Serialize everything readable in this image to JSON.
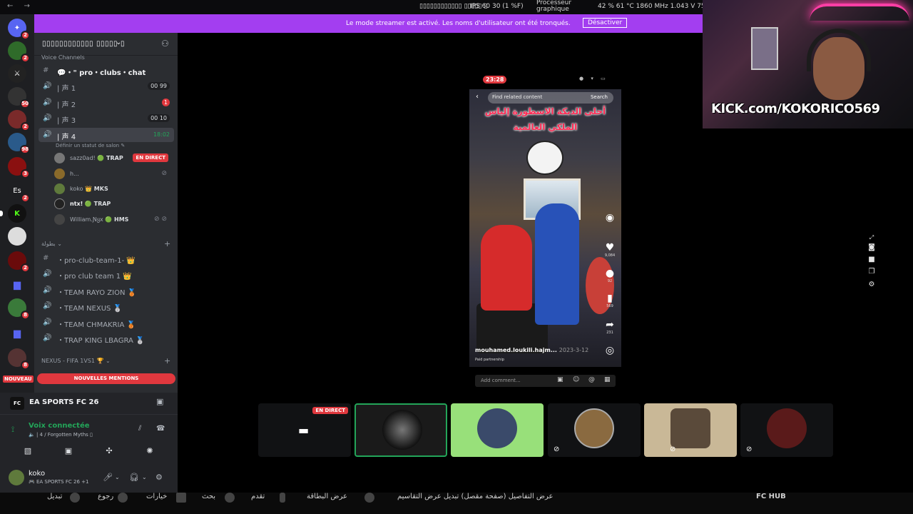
{
  "window": {
    "title": "▯▯▯▯▯▯▯▯▯▯▯▯ ▯▯▯▯▯ ▯",
    "nav_label": "← →",
    "ips": "IPS   60   30 (1 %F)",
    "processor_label": "Processeur graphique",
    "stats": "42 % 61 °C 1860 MHz 1.043 V 75 V"
  },
  "banner": {
    "message": "Le mode streamer est activé. Les noms d'utilisateur ont été tronqués.",
    "button": "Désactiver"
  },
  "server": {
    "name": "▯▯▯▯▯▯▯▯▯▯▯▯ ▯▯▯▯▯ ▯",
    "chevron": "⌄"
  },
  "server_rail": [
    {
      "icon": "discord-icon",
      "badge": "2"
    },
    {
      "icon": "server-icon",
      "badge": "2"
    },
    {
      "icon": "server-icon",
      "badge": ""
    },
    {
      "icon": "server-icon",
      "badge": "50"
    },
    {
      "icon": "server-icon",
      "badge": "2"
    },
    {
      "icon": "server-icon",
      "badge": "98"
    },
    {
      "icon": "server-icon",
      "badge": "3"
    },
    {
      "label": "Es",
      "badge": "2"
    },
    {
      "icon": "kick-icon",
      "badge": ""
    },
    {
      "icon": "server-icon",
      "badge": ""
    },
    {
      "icon": "server-icon",
      "badge": "2"
    },
    {
      "icon": "folder-icon",
      "badge": ""
    },
    {
      "icon": "server-icon",
      "badge": "8"
    },
    {
      "icon": "folder-icon",
      "badge": ""
    },
    {
      "icon": "server-icon",
      "badge": "8"
    }
  ],
  "categories": {
    "voice": "Voice Channels",
    "arabic": "بطولة ⌄",
    "nexus": "NEXUS - FIFA 1VS1 🏆 ⌄"
  },
  "channels": [
    {
      "icon": "#",
      "label": "💬・\" pro・clubs・chat",
      "count": "",
      "time": ""
    },
    {
      "icon": "🔊",
      "label": "| 声 1",
      "count": "00  99",
      "time": ""
    },
    {
      "icon": "🔊",
      "label": "| 声 2",
      "count": "1",
      "time": ""
    },
    {
      "icon": "🔊",
      "label": "| 声 3",
      "count": "00  10",
      "time": ""
    },
    {
      "icon": "🔊",
      "label": "| 声 4",
      "count": "",
      "time": "18:02"
    }
  ],
  "status_hint": "Définir un statut de salon ✎",
  "members": [
    {
      "name": "sazz0ad!",
      "tag": "🟢 TRAP",
      "live": "EN DIRECT"
    },
    {
      "name": "h...",
      "tag": "",
      "live": ""
    },
    {
      "name": "koko",
      "tag": "👑 MKS",
      "live": ""
    },
    {
      "name": "ntx!",
      "tag": "🟢 TRAP",
      "live": ""
    },
    {
      "name": "William.Ɲყx",
      "tag": "🟢 HMS",
      "live": ""
    }
  ],
  "team_channels": [
    {
      "icon": "#",
      "label": "・pro-club-team-1- 👑"
    },
    {
      "icon": "🔊",
      "label": "・pro club team 1 👑"
    },
    {
      "icon": "🔊",
      "label": "・TEAM RAYO ZION 🥉"
    },
    {
      "icon": "🔊",
      "label": "・TEAM NEXUS 🥈"
    },
    {
      "icon": "🔊",
      "label": "・TEAM CHMAKRIA 🥉"
    },
    {
      "icon": "🔊",
      "label": "・TRAP KING LBAGRA 🥈"
    }
  ],
  "mentions": "NOUVELLES MENTIONS",
  "nouveau": "NOUVEAU",
  "activity": {
    "badge": "FC",
    "name": "EA SPORTS FC 26"
  },
  "voice": {
    "status": "Voix connectée",
    "channel": "🔈 | 4 / Forgotten Myths ▯"
  },
  "user": {
    "name": "koko",
    "sub": "🎮 EA SPORTS FC 26 +1"
  },
  "phone": {
    "time": "23:28"
  },
  "video": {
    "search_placeholder": "Find related content",
    "search_button": "Search",
    "caption": "أحلى الدبكة الاسطورة إلياس الملكي العالمية",
    "likes": "9,084",
    "comments": "92",
    "saves": "569",
    "shares": "231",
    "author": "mouhamed.loukili.hajm...",
    "date": "2023-3-12",
    "paid": "Paid partnership",
    "comment_placeholder": "Add comment..."
  },
  "webcam": {
    "kick_text": "KICK.com/KOKORICO569"
  },
  "tiles": [
    {
      "live": "EN DIRECT"
    },
    {
      "live": ""
    },
    {
      "live": ""
    },
    {
      "live": ""
    },
    {
      "live": ""
    },
    {
      "live": ""
    }
  ],
  "psbar": {
    "items": [
      "تبديل",
      "رجوع",
      "خيارات",
      "بحث",
      "تقدم",
      "عرض البطاقة",
      "عرض التفاصيل (صفحة مقصل) تبديل عرض التقاسيم",
      "FC HUB"
    ]
  },
  "colors": {
    "banner": "#a33ef0",
    "mention": "#e0383e",
    "online": "#23a559",
    "kick": "#53fc18"
  }
}
